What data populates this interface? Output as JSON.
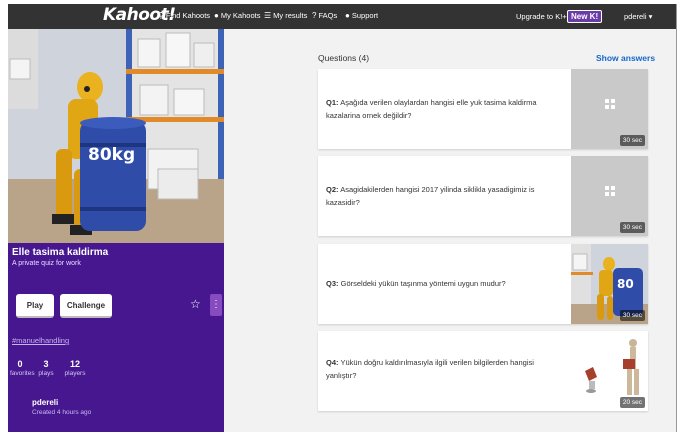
{
  "topbar": {
    "logo": "Kahoot!",
    "nav": [
      {
        "icon": "search-icon",
        "glyph": "⚲",
        "label": "Find Kahoots"
      },
      {
        "icon": "user-icon",
        "glyph": "●",
        "label": "My Kahoots"
      },
      {
        "icon": "list-icon",
        "glyph": "☰",
        "label": "My results"
      },
      {
        "icon": "help-icon",
        "glyph": "?",
        "label": "FAQs"
      },
      {
        "icon": "chat-icon",
        "glyph": "●",
        "label": "Support"
      }
    ],
    "upgrade": "Upgrade to K!+",
    "new_badge": "New K!",
    "username": "pdereli ▾"
  },
  "kahoot": {
    "title": "Elle tasima kaldirma",
    "subtitle": "A private quiz for work",
    "play_label": "Play",
    "challenge_label": "Challenge",
    "hashtag": "#manuelhandling",
    "stats": [
      {
        "value": "0",
        "label": "favorites"
      },
      {
        "value": "3",
        "label": "plays"
      },
      {
        "value": "12",
        "label": "players"
      }
    ],
    "creator": "pdereli",
    "created": "Created 4 hours ago",
    "barrel_label": "80kg"
  },
  "questions": {
    "heading": "Questions (4)",
    "show_answers": "Show answers",
    "items": [
      {
        "num": "Q1:",
        "text": "Aşağıda verilen olaylardan hangisi elle yuk tasima kaldirma kazalarina ornek değildir?",
        "time": "30 sec",
        "thumb": "placeholder"
      },
      {
        "num": "Q2:",
        "text": "Asagidakilerden hangisi 2017 yilinda siklikla yasadigimiz is kazasidir?",
        "time": "30 sec",
        "thumb": "placeholder"
      },
      {
        "num": "Q3:",
        "text": "Görseldeki yükün taşınma yöntemi uygun mudur?",
        "time": "30 sec",
        "thumb": "image"
      },
      {
        "num": "Q4:",
        "text": "Yükün doğru kaldırılmasıyla ilgili verilen bilgilerden hangisi yanlıştır?",
        "time": "20 sec",
        "thumb": "image"
      }
    ]
  },
  "colors": {
    "topbar": "#333333",
    "purple": "#46178f",
    "link_blue": "#1368ce"
  }
}
